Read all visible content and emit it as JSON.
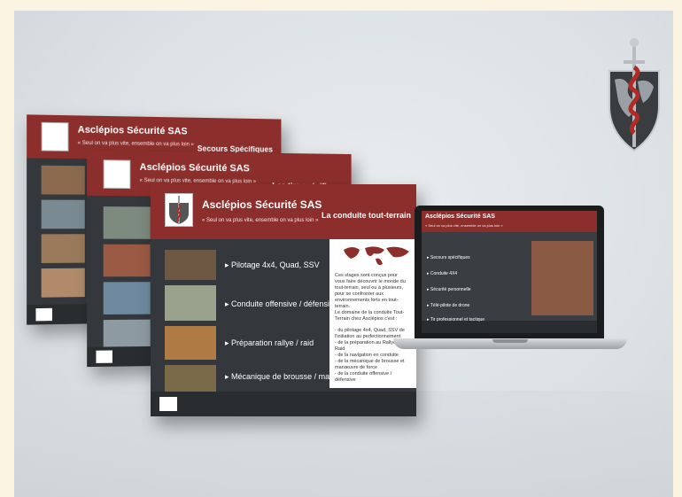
{
  "brand": {
    "company": "Asclépios Sécurité SAS",
    "motto": "« Seul on va plus vite, ensemble on va plus loin »"
  },
  "cards": {
    "back": {
      "subtitle": "Secours Spécifiques"
    },
    "middle": {
      "subtitle": "Les tirs spécifiques"
    },
    "front": {
      "subtitle": "La conduite tout-terrain",
      "menu": [
        "Pilotage 4x4, Quad, SSV",
        "Conduite offensive / défensive",
        "Préparation rallye / raid",
        "Mécanique de brousse / manœuvre de force"
      ],
      "para1": "Ces stages sont conçus pour vous faire découvrir le monde du tout-terrain, seul ou à plusieurs, pour se confronter aux environnements forts en tout-terrain.",
      "para2": "Le domaine de la conduite Tout-Terrain chez Asclépios c'est :",
      "para3": "- du pilotage 4x4, Quad, SSV de l'initiation au perfectionnement\n- de la préparation au Rallye / Raid\n- de la navigation en conduite\n- de la mécanique de brousse et manœuvre de force\n- de la conduite offensive / défensive"
    }
  },
  "laptop": {
    "company": "Asclépios Sécurité SAS",
    "motto": "« Seul on va plus vite, ensemble on va plus loin »",
    "menu": [
      "Secours spécifiques",
      "Conduite 4X4",
      "Sécurité personnelle",
      "Télé-pilote de drone",
      "Tir professionnel et tactique"
    ]
  },
  "colors": {
    "accent": "#8c2f2c",
    "panel": "#34383c",
    "background": "#dde2e5"
  },
  "icons": [
    "asclepius-emblem-icon",
    "arrow-right-icon"
  ]
}
